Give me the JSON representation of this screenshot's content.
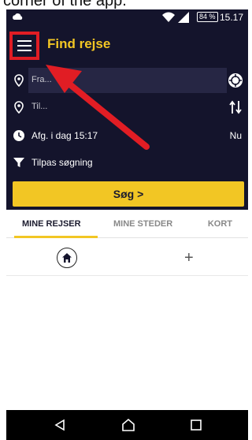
{
  "caption": {
    "text": "corner of the app."
  },
  "status_bar": {
    "battery": "84 %",
    "time": "15.17"
  },
  "header": {
    "title": "Find rejse"
  },
  "form": {
    "from_placeholder": "Fra...",
    "to_placeholder": "Til...",
    "departure_label": "Afg.  i dag  15:17",
    "now_label": "Nu",
    "filter_label": "Tilpas søgning",
    "search_label": "Søg >"
  },
  "tabs": [
    {
      "label": "MINE REJSER",
      "active": true
    },
    {
      "label": "MINE STEDER",
      "active": false
    },
    {
      "label": "KORT",
      "active": false
    }
  ],
  "quick_row": {
    "add_label": "+"
  },
  "colors": {
    "header_bg": "#14142c",
    "accent": "#f2c624",
    "highlight": "#e11d24"
  },
  "icons": [
    "cloud-icon",
    "wifi-icon",
    "signal-icon",
    "menu-icon",
    "location-pin-icon",
    "add-stop-icon",
    "swap-icon",
    "clock-icon",
    "filter-icon",
    "home-icon",
    "back-icon",
    "nav-home-icon",
    "recent-apps-icon",
    "annotation-arrow"
  ]
}
